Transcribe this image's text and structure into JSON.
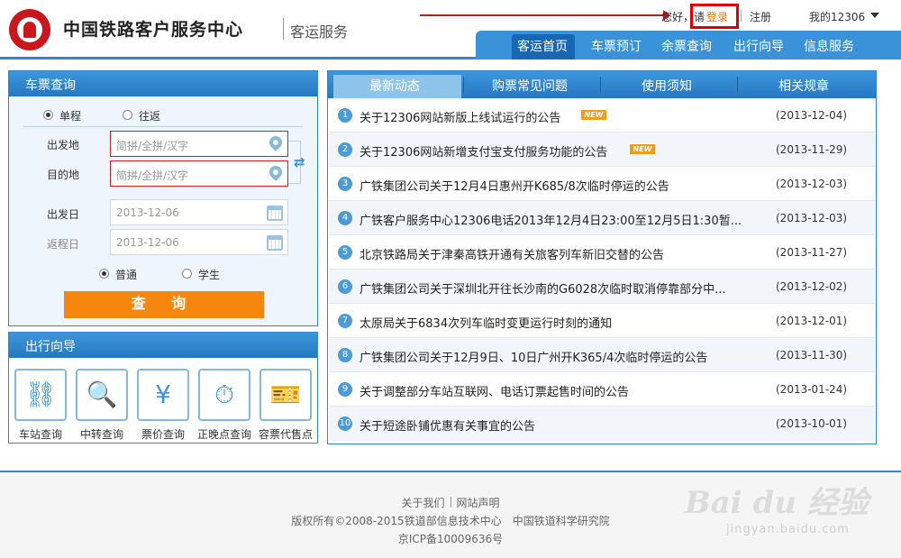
{
  "header": {
    "site_title": "中国铁路客户服务中心",
    "site_sub": "客运服务",
    "greeting": "您好，请",
    "login": "登录",
    "register": "注册",
    "account": "我的12306"
  },
  "nav": [
    "客运首页",
    "车票预订",
    "余票查询",
    "出行向导",
    "信息服务"
  ],
  "query": {
    "title": "车票查询",
    "trip_types": [
      "单程",
      "往返"
    ],
    "from_label": "出发地",
    "to_label": "目的地",
    "from_placeholder": "简拼/全拼/汉字",
    "to_placeholder": "简拼/全拼/汉字",
    "depart_label": "出发日",
    "return_label": "返程日",
    "depart_date": "2013-12-06",
    "return_date": "2013-12-06",
    "ticket_types": [
      "普通",
      "学生"
    ],
    "submit": "查 询"
  },
  "guide": {
    "title": "出行向导",
    "items": [
      {
        "label": "车站查询",
        "icon": "station-icon",
        "glyph": "⛓"
      },
      {
        "label": "中转查询",
        "icon": "transfer-search-icon",
        "glyph": "🔍"
      },
      {
        "label": "票价查询",
        "icon": "fare-icon",
        "glyph": "¥"
      },
      {
        "label": "正晚点查询",
        "icon": "clock-icon",
        "glyph": "⏱"
      },
      {
        "label": "容票代售点",
        "icon": "ticket-agency-icon",
        "glyph": "🎫"
      }
    ]
  },
  "news": {
    "tabs": [
      "最新动态",
      "购票常见问题",
      "使用须知",
      "相关规章"
    ],
    "badge": "NEW",
    "items": [
      {
        "num": "1",
        "title": "关于12306网站新版上线试运行的公告",
        "date": "(2013-12-04)",
        "new": true
      },
      {
        "num": "2",
        "title": "关于12306网站新增支付宝支付服务功能的公告",
        "date": "(2013-11-29)",
        "new": true
      },
      {
        "num": "3",
        "title": "广铁集团公司关于12月4日惠州开K685/8次临时停运的公告",
        "date": "(2013-12-03)",
        "new": false
      },
      {
        "num": "4",
        "title": "广铁客户服务中心12306电话2013年12月4日23:00至12月5日1:30暂...",
        "date": "(2013-12-03)",
        "new": false
      },
      {
        "num": "5",
        "title": "北京铁路局关于津秦高铁开通有关旅客列车新旧交替的公告",
        "date": "(2013-11-27)",
        "new": false
      },
      {
        "num": "6",
        "title": "广铁集团公司关于深圳北开往长沙南的G6028次临时取消停靠部分中...",
        "date": "(2013-12-02)",
        "new": false
      },
      {
        "num": "7",
        "title": "太原局关于6834次列车临时变更运行时刻的通知",
        "date": "(2013-12-01)",
        "new": false
      },
      {
        "num": "8",
        "title": "广铁集团公司关于12月9日、10日广州开K365/4次临时停运的公告",
        "date": "(2013-11-30)",
        "new": false
      },
      {
        "num": "9",
        "title": "关于调整部分车站互联网、电话订票起售时间的公告",
        "date": "(2013-01-24)",
        "new": false
      },
      {
        "num": "10",
        "title": "关于短途卧铺优惠有关事宜的公告",
        "date": "(2013-10-01)",
        "new": false
      }
    ]
  },
  "footer": {
    "about": "关于我们",
    "statement": "网站声明",
    "copyright": "版权所有©2008-2015铁道部信息技术中心　中国铁道科学研究院",
    "icp": "京ICP备10009636号"
  },
  "watermark": {
    "main": "Bai du 经验",
    "sub": "jingyan.baidu.com"
  }
}
